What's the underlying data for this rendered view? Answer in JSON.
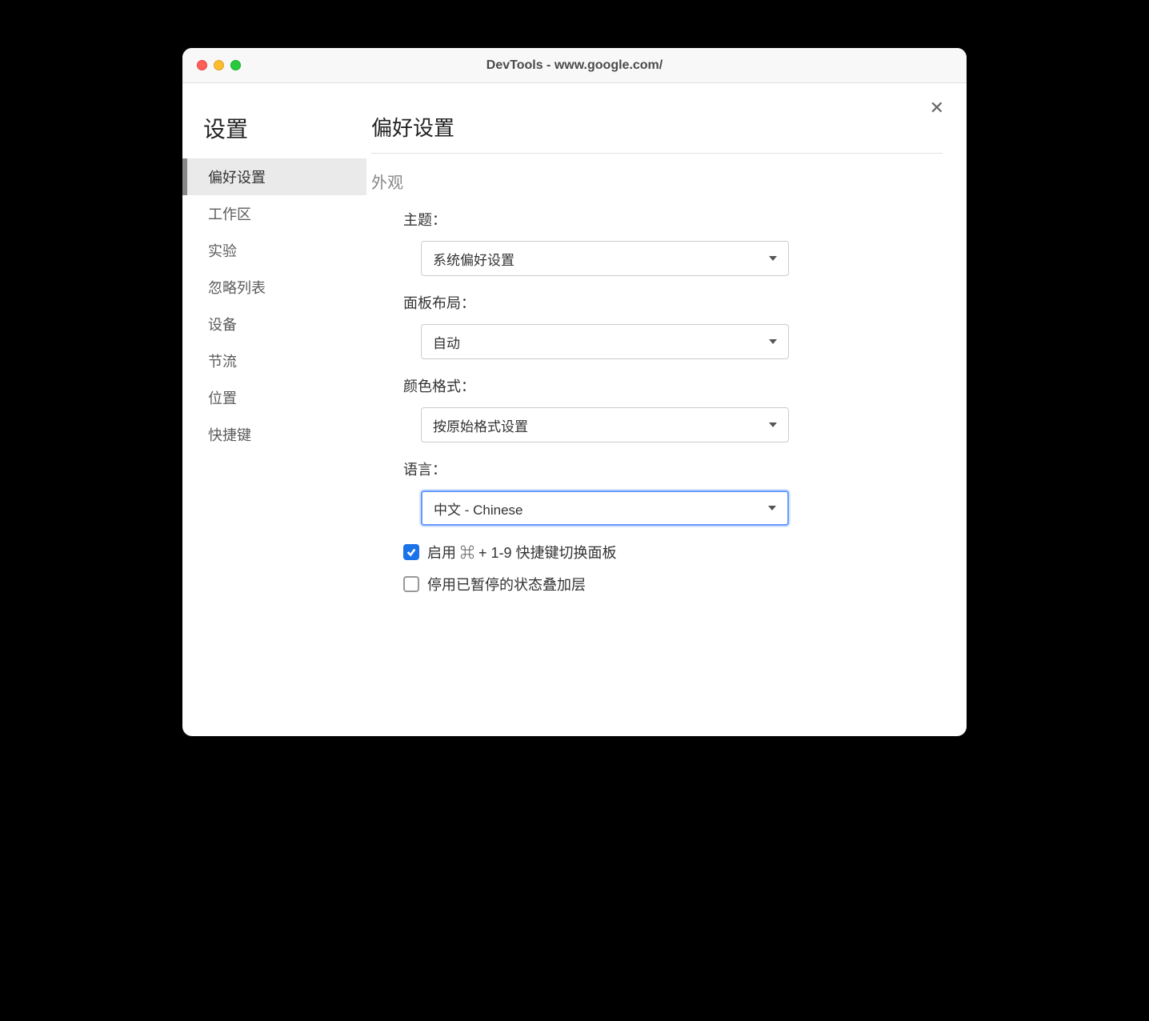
{
  "window": {
    "title": "DevTools - www.google.com/"
  },
  "sidebar": {
    "title": "设置",
    "items": [
      {
        "label": "偏好设置",
        "active": true
      },
      {
        "label": "工作区",
        "active": false
      },
      {
        "label": "实验",
        "active": false
      },
      {
        "label": "忽略列表",
        "active": false
      },
      {
        "label": "设备",
        "active": false
      },
      {
        "label": "节流",
        "active": false
      },
      {
        "label": "位置",
        "active": false
      },
      {
        "label": "快捷键",
        "active": false
      }
    ]
  },
  "main": {
    "title": "偏好设置",
    "section": "外观",
    "fields": {
      "theme": {
        "label": "主题：",
        "value": "系统偏好设置"
      },
      "panelLayout": {
        "label": "面板布局：",
        "value": "自动"
      },
      "colorFormat": {
        "label": "颜色格式：",
        "value": "按原始格式设置"
      },
      "language": {
        "label": "语言：",
        "value": "中文 - Chinese",
        "focused": true
      }
    },
    "checkboxes": {
      "shortcutPanel": {
        "label": "启用 ⌘ + 1-9 快捷键切换面板",
        "checked": true
      },
      "pausedOverlay": {
        "label": "停用已暂停的状态叠加层",
        "checked": false
      }
    }
  }
}
